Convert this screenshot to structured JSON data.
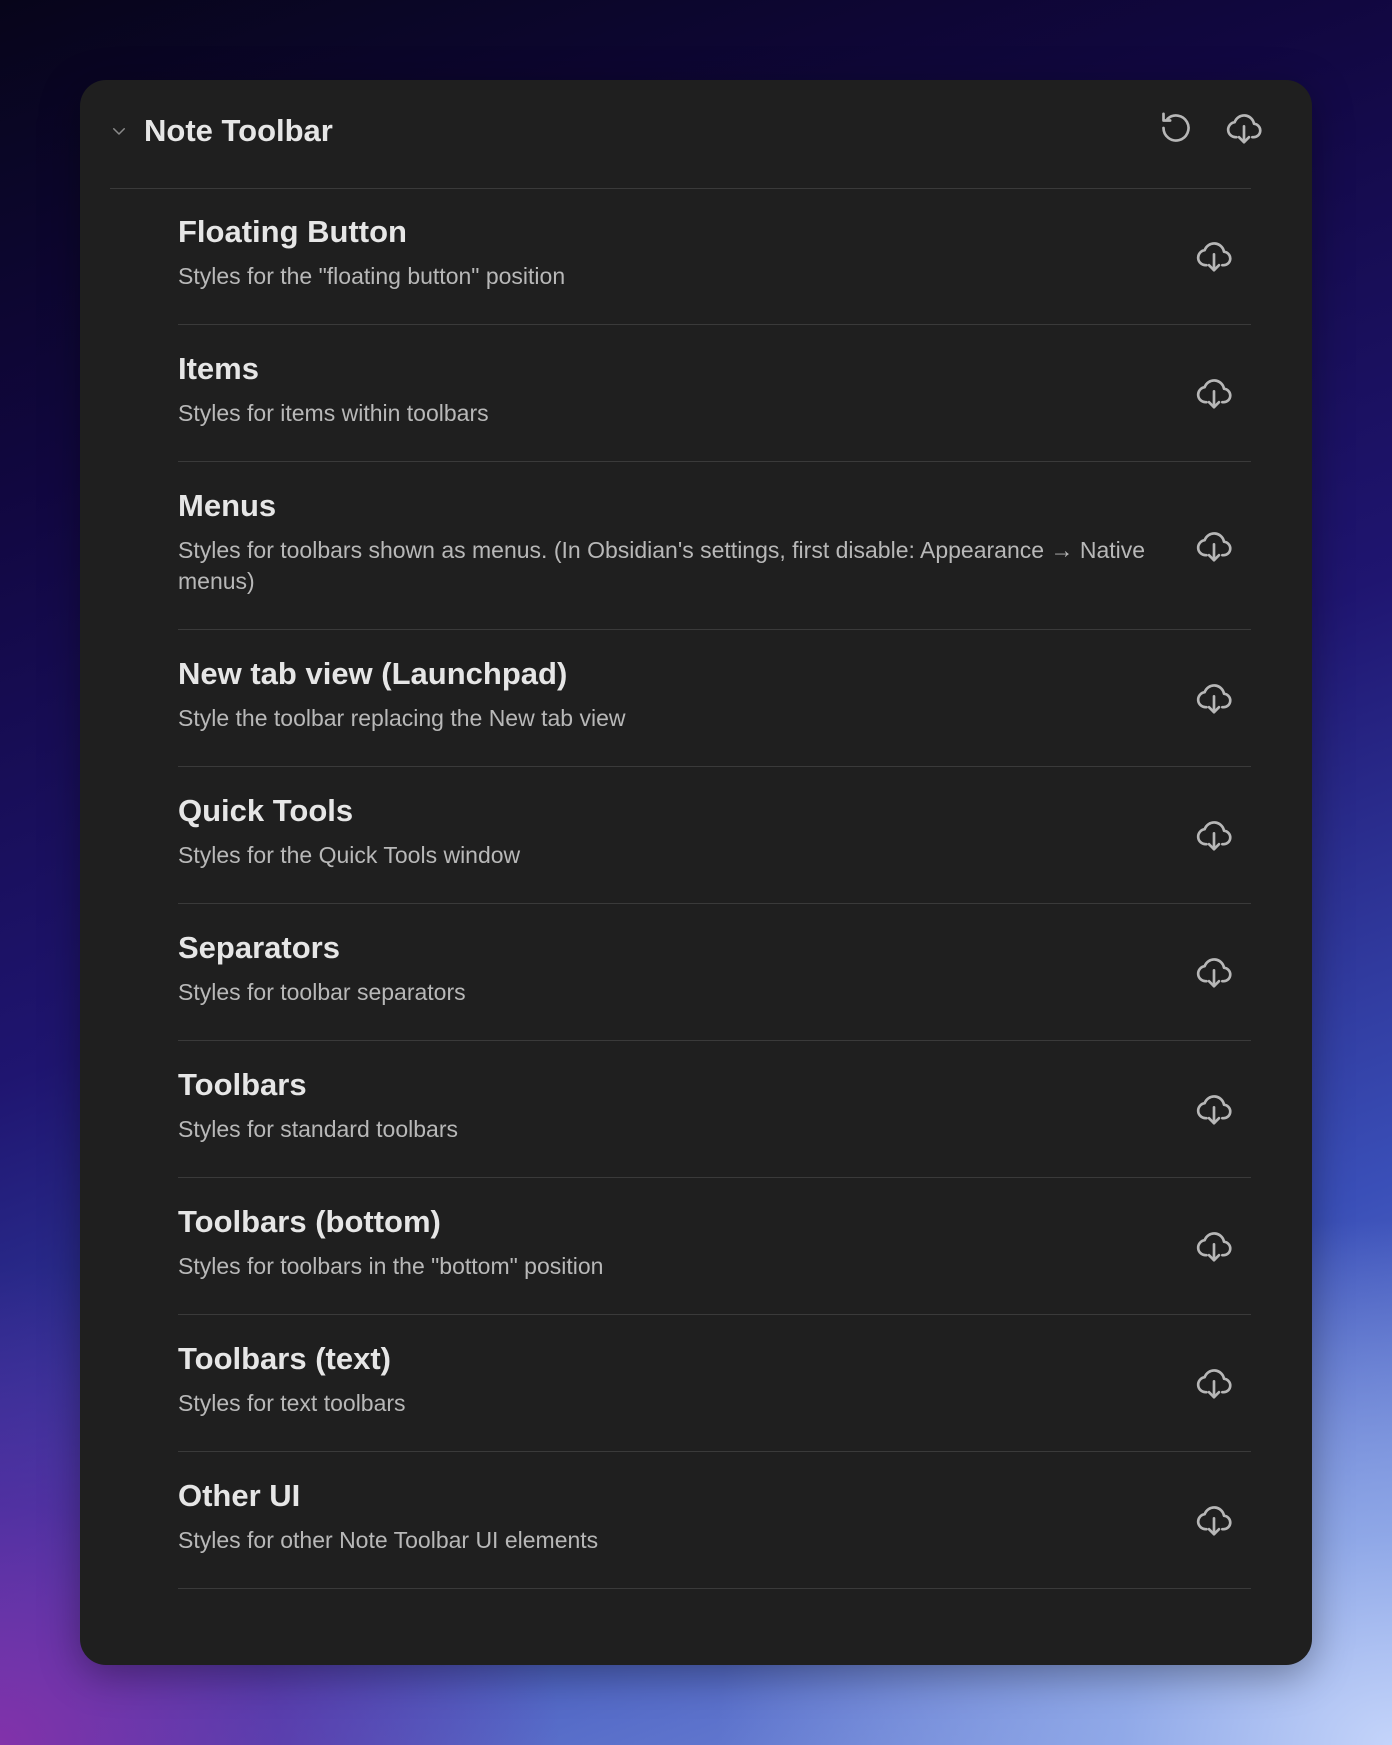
{
  "header": {
    "title": "Note Toolbar",
    "icons": {
      "collapse": "chevron-down-icon",
      "reset": "reset-icon",
      "download": "cloud-download-icon"
    }
  },
  "items": [
    {
      "title": "Floating Button",
      "description": "Styles for the \"floating button\" position"
    },
    {
      "title": "Items",
      "description": "Styles for items within toolbars"
    },
    {
      "title": "Menus",
      "description": "Styles for toolbars shown as menus. (In Obsidian's settings, first disable: Appearance → Native menus)"
    },
    {
      "title": "New tab view (Launchpad)",
      "description": "Style the toolbar replacing the New tab view"
    },
    {
      "title": "Quick Tools",
      "description": "Styles for the Quick Tools window"
    },
    {
      "title": "Separators",
      "description": "Styles for toolbar separators"
    },
    {
      "title": "Toolbars",
      "description": "Styles for standard toolbars"
    },
    {
      "title": "Toolbars (bottom)",
      "description": "Styles for toolbars in the \"bottom\" position"
    },
    {
      "title": "Toolbars (text)",
      "description": "Styles for text toolbars"
    },
    {
      "title": "Other UI",
      "description": "Styles for other Note Toolbar UI elements"
    }
  ],
  "colors": {
    "panel": "#1f1f1f",
    "title_text": "#e6e6e6",
    "desc_text": "#b8b8b8",
    "divider": "#3a3a3a",
    "icon": "#b7b7b7"
  }
}
